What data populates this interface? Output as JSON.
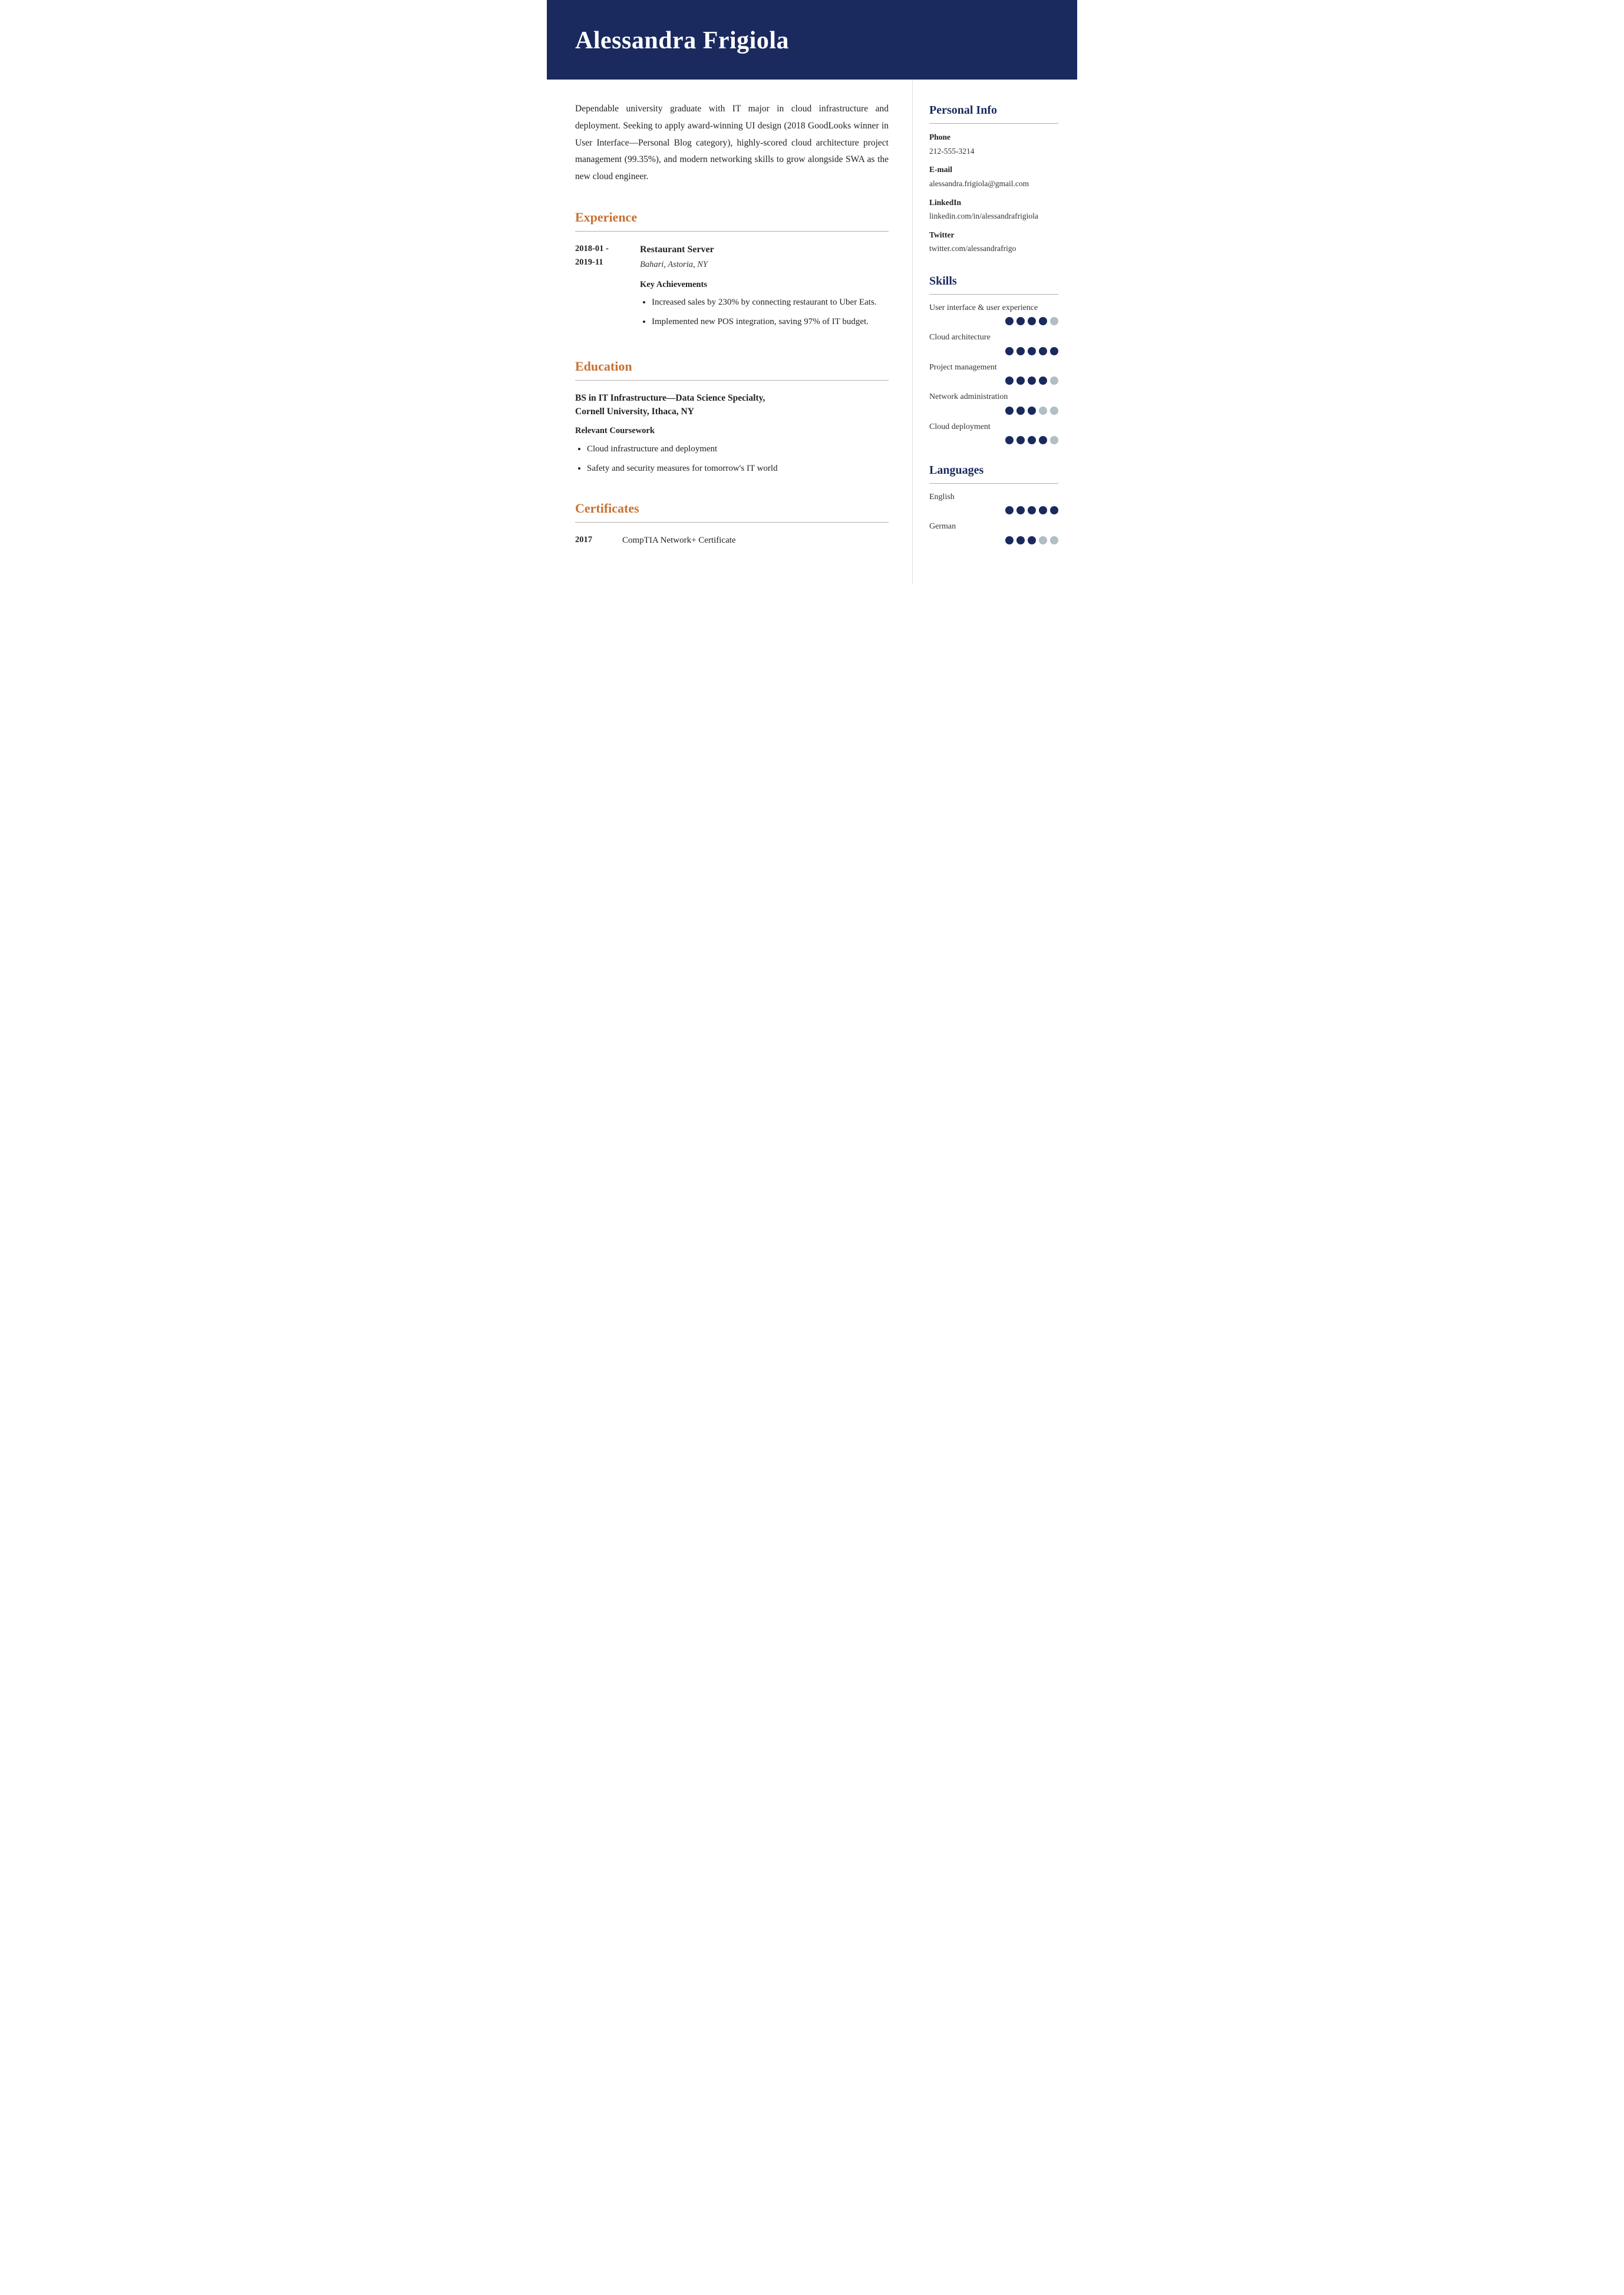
{
  "header": {
    "name": "Alessandra Frigiola"
  },
  "summary": "Dependable university graduate with IT major in cloud infrastructure and deployment. Seeking to apply award-winning UI design (2018 GoodLooks winner in User Interface—Personal Blog category), highly-scored cloud architecture project management (99.35%), and modern networking skills to grow alongside SWA as the new cloud engineer.",
  "sections": {
    "experience": {
      "label": "Experience",
      "entries": [
        {
          "date_start": "2018-01 -",
          "date_end": "2019-11",
          "title": "Restaurant Server",
          "company": "Bahari, Astoria, NY",
          "achievements_label": "Key Achievements",
          "achievements": [
            "Increased sales by 230% by connecting restaurant to Uber Eats.",
            "Implemented new POS integration, saving 97% of IT budget."
          ]
        }
      ]
    },
    "education": {
      "label": "Education",
      "degree": "BS in IT Infrastructure—Data Science Specialty,",
      "school": "Cornell University, Ithaca, NY",
      "coursework_label": "Relevant Coursework",
      "coursework": [
        "Cloud infrastructure and deployment",
        "Safety and security measures for tomorrow's IT world"
      ]
    },
    "certificates": {
      "label": "Certificates",
      "entries": [
        {
          "year": "2017",
          "name": "CompTIA Network+ Certificate"
        }
      ]
    }
  },
  "sidebar": {
    "personal_info": {
      "label": "Personal Info",
      "fields": [
        {
          "label": "Phone",
          "value": "212-555-3214"
        },
        {
          "label": "E-mail",
          "value": "alessandra.frigiola@gmail.com"
        },
        {
          "label": "LinkedIn",
          "value": "linkedin.com/in/alessandrafrigiola"
        },
        {
          "label": "Twitter",
          "value": "twitter.com/alessandrafrigo"
        }
      ]
    },
    "skills": {
      "label": "Skills",
      "items": [
        {
          "name": "User interface & user experience",
          "filled": 4,
          "total": 5
        },
        {
          "name": "Cloud architecture",
          "filled": 5,
          "total": 5
        },
        {
          "name": "Project management",
          "filled": 4,
          "total": 5
        },
        {
          "name": "Network administration",
          "filled": 3,
          "total": 5
        },
        {
          "name": "Cloud deployment",
          "filled": 4,
          "total": 5
        }
      ]
    },
    "languages": {
      "label": "Languages",
      "items": [
        {
          "name": "English",
          "filled": 5,
          "total": 5
        },
        {
          "name": "German",
          "filled": 3,
          "total": 5
        }
      ]
    }
  }
}
